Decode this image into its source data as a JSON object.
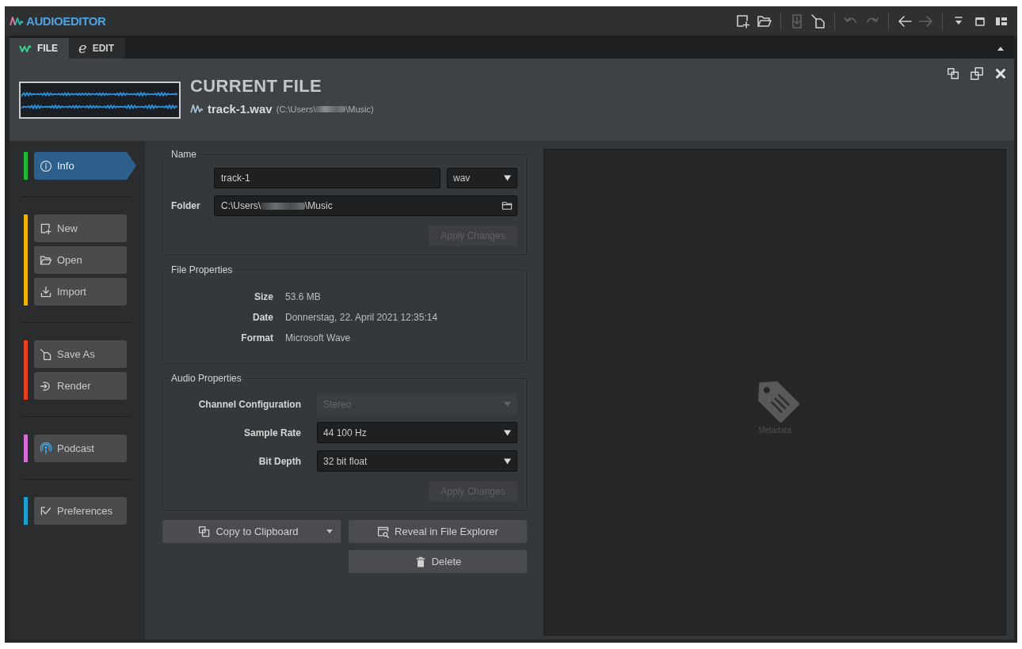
{
  "app": {
    "title": "AUDIOEDITOR"
  },
  "toolbar": [
    {
      "items": [
        {
          "kind": "new",
          "disabled": false
        },
        {
          "kind": "open",
          "disabled": false
        }
      ]
    },
    {
      "items": [
        {
          "kind": "save",
          "disabled": true
        },
        {
          "kind": "save_as",
          "disabled": false
        }
      ]
    },
    {
      "items": [
        {
          "kind": "undo",
          "disabled": true
        },
        {
          "kind": "redo",
          "disabled": true
        }
      ]
    },
    {
      "items": [
        {
          "kind": "back",
          "disabled": false
        },
        {
          "kind": "forward",
          "disabled": true
        }
      ]
    },
    {
      "items": [
        {
          "kind": "menu_down",
          "disabled": false
        },
        {
          "kind": "window",
          "disabled": false
        },
        {
          "kind": "layout",
          "disabled": false
        }
      ]
    }
  ],
  "tabs": [
    {
      "label": "FILE",
      "selected": true
    },
    {
      "label": "EDIT",
      "glyph": "e",
      "selected": false
    }
  ],
  "header": {
    "title": "CURRENT FILE",
    "file_name": "track-1.wav",
    "path": {
      "prefix": "(C:\\Users\\",
      "redacted": true,
      "suffix": "\\Music)"
    }
  },
  "sidebar": {
    "groups": [
      {
        "color": "#1fb83a",
        "items": [
          {
            "kind": "info",
            "label": "Info",
            "selected": true
          }
        ]
      },
      {
        "color": "#f0b400",
        "items": [
          {
            "kind": "new",
            "label": "New",
            "selected": false
          },
          {
            "kind": "open",
            "label": "Open",
            "selected": false
          },
          {
            "kind": "import",
            "label": "Import",
            "selected": false
          }
        ]
      },
      {
        "color": "#e8401c",
        "items": [
          {
            "kind": "save_as",
            "label": "Save As",
            "selected": false
          },
          {
            "kind": "render",
            "label": "Render",
            "selected": false
          }
        ]
      },
      {
        "color": "#d66bd6",
        "items": [
          {
            "kind": "podcast",
            "label": "Podcast",
            "selected": false
          }
        ]
      },
      {
        "color": "#1e9fd0",
        "items": [
          {
            "kind": "preferences",
            "label": "Preferences",
            "selected": false
          }
        ]
      }
    ]
  },
  "name_section": {
    "legend": "Name",
    "name_value": "track-1",
    "extension": "wav",
    "folder_label": "Folder",
    "folder": {
      "prefix": "C:\\Users\\",
      "redacted": true,
      "suffix": "\\Music"
    },
    "apply": {
      "label": "Apply Changes",
      "disabled": true
    }
  },
  "file_properties": {
    "legend": "File Properties",
    "rows": [
      {
        "label": "Size",
        "value": "53.6 MB"
      },
      {
        "label": "Date",
        "value": "Donnerstag, 22. April 2021 12:35:14"
      },
      {
        "label": "Format",
        "value": "Microsoft Wave"
      }
    ]
  },
  "audio_properties": {
    "legend": "Audio Properties",
    "rows": [
      {
        "label": "Channel Configuration",
        "value": "Stereo",
        "disabled": true
      },
      {
        "label": "Sample Rate",
        "value": "44 100 Hz",
        "disabled": false
      },
      {
        "label": "Bit Depth",
        "value": "32 bit float",
        "disabled": false
      }
    ],
    "apply": {
      "label": "Apply Changes",
      "disabled": true
    }
  },
  "actions": [
    {
      "kind": "copy",
      "label": "Copy to Clipboard",
      "dropdown": true
    },
    {
      "kind": "reveal",
      "label": "Reveal in File Explorer",
      "dropdown": false
    },
    {
      "kind": "delete",
      "label": "Delete",
      "dropdown": false
    }
  ],
  "metadata": {
    "label": "Metadata"
  }
}
